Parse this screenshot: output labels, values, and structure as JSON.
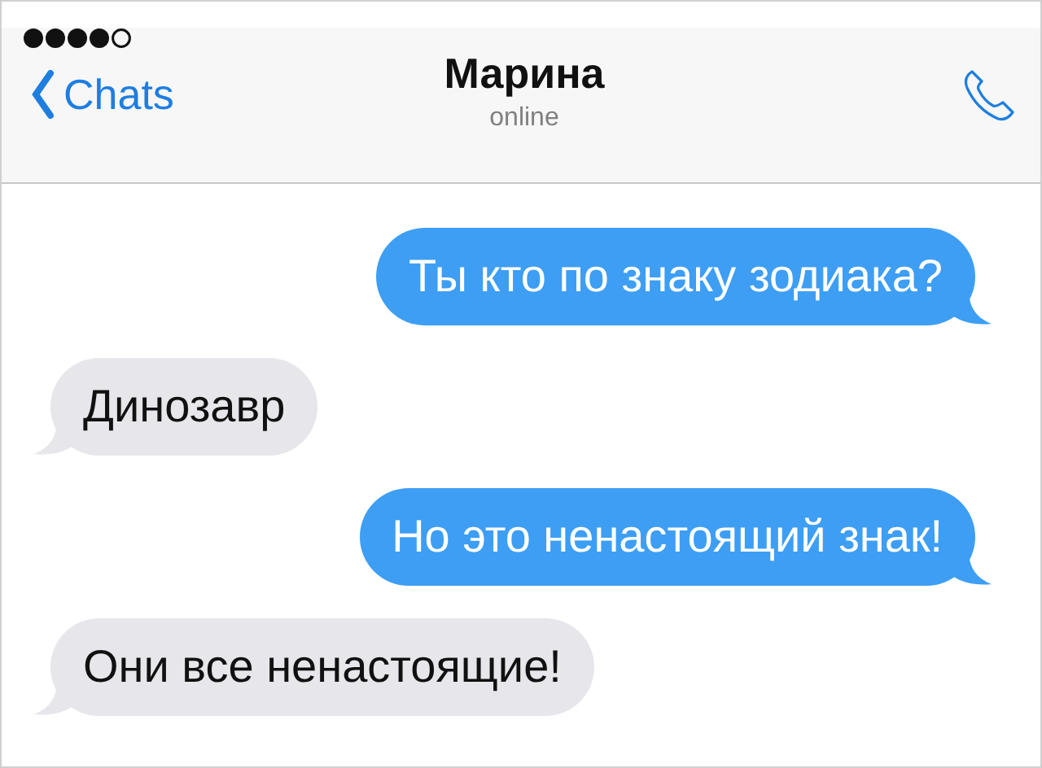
{
  "header": {
    "back_label": "Chats",
    "title": "Марина",
    "status": "online"
  },
  "messages": [
    {
      "kind": "outgoing",
      "text": "Ты кто по знаку зодиака?"
    },
    {
      "kind": "incoming",
      "text": "Динозавр"
    },
    {
      "kind": "outgoing",
      "text": "Но это ненастоящий знак!"
    },
    {
      "kind": "incoming",
      "text": "Они все ненастоящие!"
    }
  ]
}
